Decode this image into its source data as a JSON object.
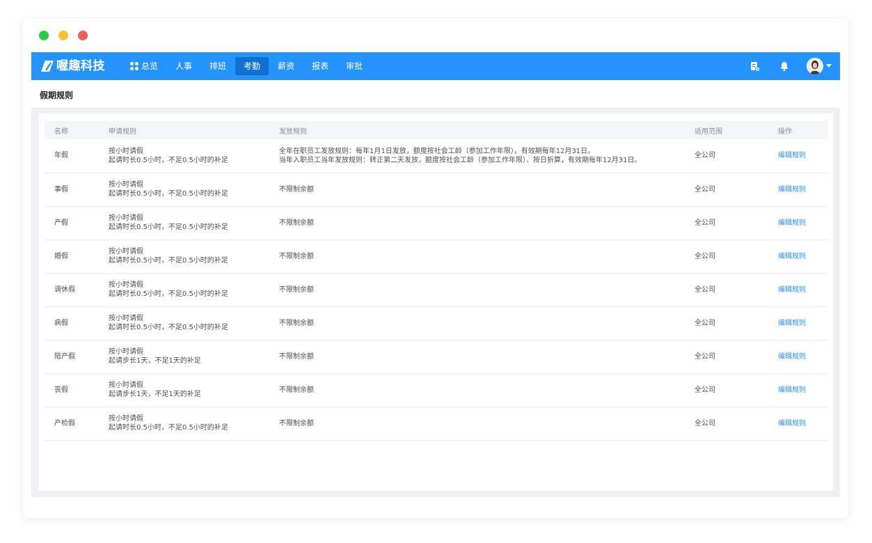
{
  "brand": {
    "name": "喔趣科技"
  },
  "nav": [
    {
      "label": "总览",
      "icon": "grid-icon",
      "active": false
    },
    {
      "label": "人事",
      "active": false
    },
    {
      "label": "排班",
      "active": false
    },
    {
      "label": "考勤",
      "active": true
    },
    {
      "label": "薪资",
      "active": false
    },
    {
      "label": "报表",
      "active": false
    },
    {
      "label": "审批",
      "active": false
    }
  ],
  "toolbar": {
    "icons": [
      "document-settings-icon",
      "bell-icon",
      "avatar",
      "caret-down-icon"
    ]
  },
  "page": {
    "title": "假期规则"
  },
  "table": {
    "headers": [
      "名称",
      "申请规则",
      "发放规则",
      "适用范围",
      "操作"
    ],
    "rows": [
      {
        "name": "年假",
        "apply": [
          "按小时请假",
          "起请时长0.5小时，不足0.5小时的补足"
        ],
        "grant": [
          "全年在职员工发放规则：每年1月1日发放，额度按社会工龄（参加工作年限），有效期每年12月31日。",
          "当年入职员工当年发放规则：转正第二天发放，额度按社会工龄（参加工作年限）、按日折算，有效期每年12月31日。"
        ],
        "scope": "全公司",
        "action": "编辑规则"
      },
      {
        "name": "事假",
        "apply": [
          "按小时请假",
          "起请时长0.5小时，不足0.5小时的补足"
        ],
        "grant": [
          "不限制余额"
        ],
        "scope": "全公司",
        "action": "编辑规则"
      },
      {
        "name": "产假",
        "apply": [
          "按小时请假",
          "起请时长0.5小时，不足0.5小时的补足"
        ],
        "grant": [
          "不限制余额"
        ],
        "scope": "全公司",
        "action": "编辑规则"
      },
      {
        "name": "婚假",
        "apply": [
          "按小时请假",
          "起请时长0.5小时，不足0.5小时的补足"
        ],
        "grant": [
          "不限制余额"
        ],
        "scope": "全公司",
        "action": "编辑规则"
      },
      {
        "name": "调休假",
        "apply": [
          "按小时请假",
          "起请时长0.5小时，不足0.5小时的补足"
        ],
        "grant": [
          "不限制余额"
        ],
        "scope": "全公司",
        "action": "编辑规则"
      },
      {
        "name": "病假",
        "apply": [
          "按小时请假",
          "起请时长0.5小时，不足0.5小时的补足"
        ],
        "grant": [
          "不限制余额"
        ],
        "scope": "全公司",
        "action": "编辑规则"
      },
      {
        "name": "陪产假",
        "apply": [
          "按小时请假",
          "起请步长1天，不足1天的补足"
        ],
        "grant": [
          "不限制余额"
        ],
        "scope": "全公司",
        "action": "编辑规则"
      },
      {
        "name": "丧假",
        "apply": [
          "按小时请假",
          "起请步长1天，不足1天的补足"
        ],
        "grant": [
          "不限制余额"
        ],
        "scope": "全公司",
        "action": "编辑规则"
      },
      {
        "name": "产检假",
        "apply": [
          "按小时请假",
          "起请时长0.5小时，不足0.5小时的补足"
        ],
        "grant": [
          "不限制余额"
        ],
        "scope": "全公司",
        "action": "编辑规则"
      }
    ]
  },
  "colors": {
    "primary": "#2593fc",
    "nav_active": "#0f70cf",
    "link": "#2b8ef5"
  }
}
